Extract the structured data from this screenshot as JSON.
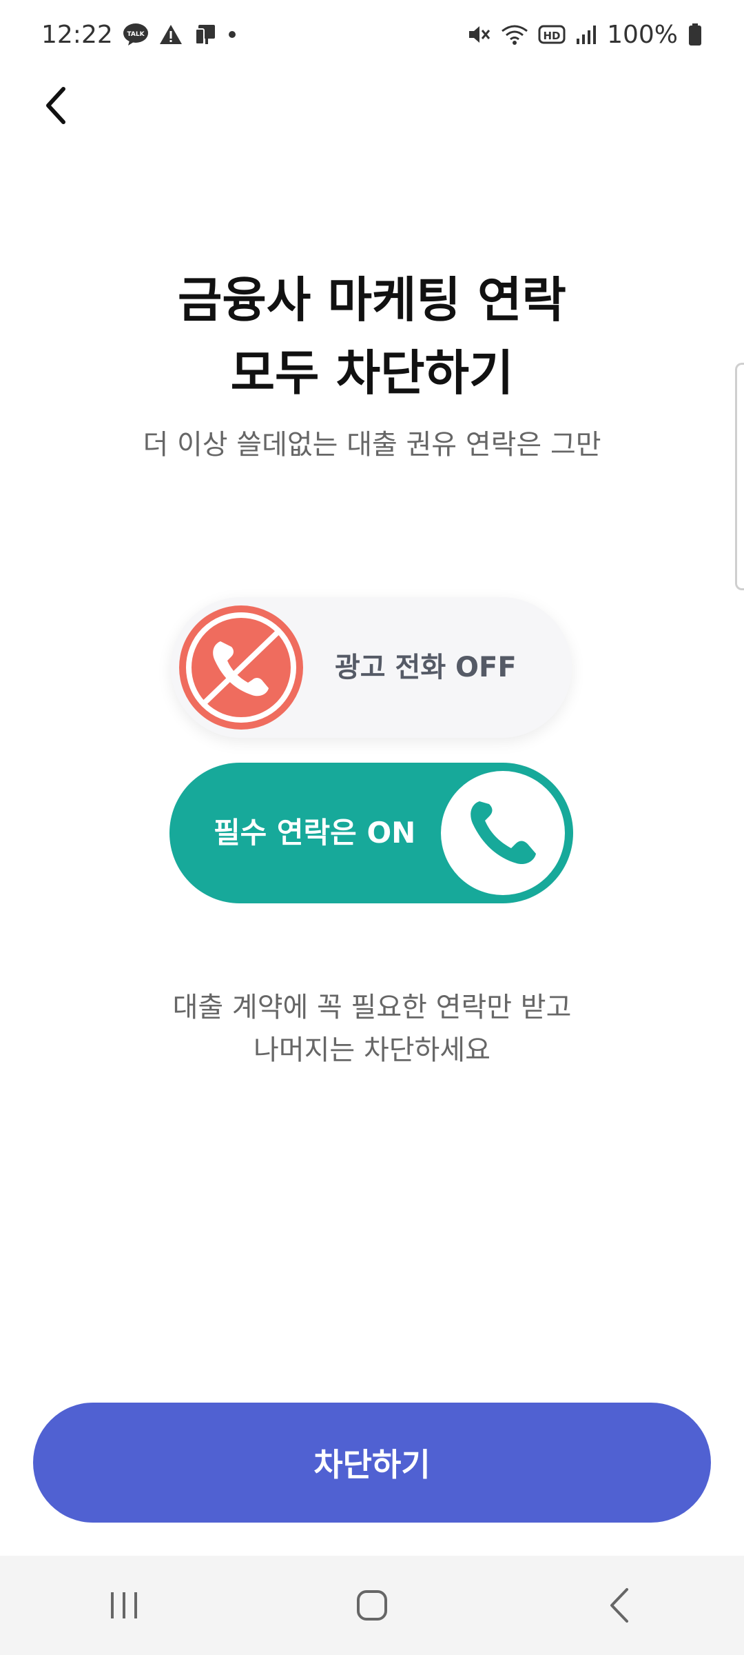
{
  "status_bar": {
    "time": "12:22",
    "battery": "100%",
    "icons_left": [
      "kakaotalk-icon",
      "warning-icon",
      "device-icon",
      "dot-icon"
    ],
    "icons_right": [
      "mute-icon",
      "wifi-icon",
      "hd-icon",
      "signal-icon",
      "battery-icon"
    ]
  },
  "header": {
    "back_icon": "chevron-left-icon"
  },
  "main": {
    "title_line1": "금융사 마케팅 연락",
    "title_line2": "모두 차단하기",
    "subtitle": "더 이상 쓸데없는 대출 권유 연락은 그만",
    "off_pill": {
      "label": "광고 전화 OFF",
      "icon": "phone-blocked-icon",
      "color": "#ef6c5e"
    },
    "on_pill": {
      "label": "필수 연락은 ON",
      "icon": "phone-icon",
      "color": "#17a99a"
    },
    "description_line1": "대출 계약에 꼭 필요한 연락만 받고",
    "description_line2": "나머지는 차단하세요"
  },
  "cta": {
    "label": "차단하기",
    "color": "#5061d2"
  },
  "nav_bar": {
    "icons": [
      "recent-apps-icon",
      "home-icon",
      "back-icon"
    ]
  }
}
